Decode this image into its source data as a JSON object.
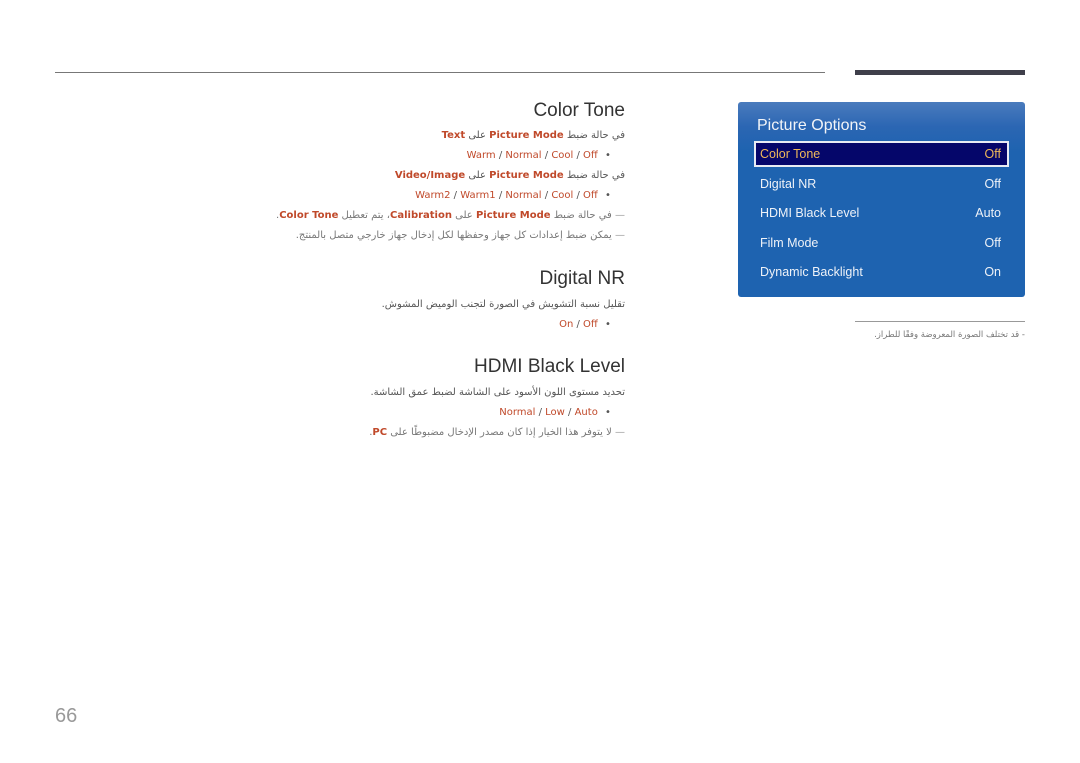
{
  "page_number": "66",
  "sections": {
    "color_tone": {
      "title": "Color Tone",
      "cond1_prefix": "في حالة ضبط ",
      "cond1_mode": "Picture Mode",
      "cond1_mid": " على ",
      "cond1_value": "Text",
      "options1": [
        "Warm",
        "Normal",
        "Cool",
        "Off"
      ],
      "cond2_prefix": "في حالة ضبط ",
      "cond2_mode": "Picture Mode",
      "cond2_mid": " على ",
      "cond2_value": "Video/Image",
      "options2": [
        "Warm2",
        "Warm1",
        "Normal",
        "Cool",
        "Off"
      ],
      "note1_prefix": "في حالة ضبط ",
      "note1_mode": "Picture Mode",
      "note1_mid": " على ",
      "note1_value": "Calibration",
      "note1_mid2": "، يتم تعطيل ",
      "note1_target": "Color Tone",
      "note1_end": ".",
      "note2": "يمكن ضبط إعدادات كل جهاز وحفظها لكل إدخال جهاز خارجي متصل بالمنتج."
    },
    "digital_nr": {
      "title": "Digital NR",
      "desc": "تقليل نسبة التشويش في الصورة لتجنب الوميض المشوش.",
      "options": [
        "On",
        "Off"
      ]
    },
    "hdmi_black_level": {
      "title": "HDMI Black Level",
      "desc": "تحديد مستوى اللون الأسود على الشاشة لضبط عمق الشاشة.",
      "options": [
        "Normal",
        "Low",
        "Auto"
      ],
      "note_prefix": "لا يتوفر هذا الخيار إذا كان مصدر الإدخال مضبوطًا على ",
      "note_value": "PC",
      "note_end": "."
    }
  },
  "separator": " / ",
  "note_dash": "—",
  "bullet": "•",
  "osd_panel": {
    "title": "Picture Options",
    "items": [
      {
        "label": "Color Tone",
        "value": "Off",
        "selected": true
      },
      {
        "label": "Digital NR",
        "value": "Off"
      },
      {
        "label": "HDMI Black Level",
        "value": "Auto"
      },
      {
        "label": "Film Mode",
        "value": "Off"
      },
      {
        "label": "Dynamic Backlight",
        "value": "On"
      }
    ],
    "colors": {
      "panel": "#1e63b0",
      "selected_bg": "#05066a",
      "selected_text": "#f0b85a"
    }
  },
  "side_note": "-  قد تختلف الصورة المعروضة وفقًا للطراز.",
  "accent_color": "#c0492a"
}
